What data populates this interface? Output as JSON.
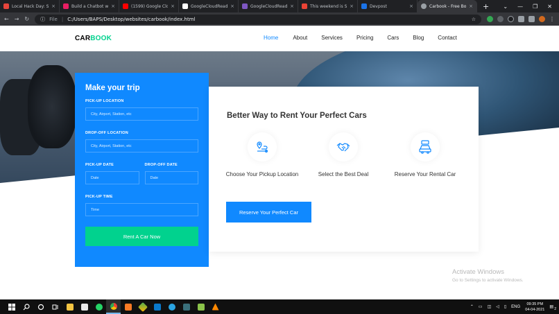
{
  "browser": {
    "tabs": [
      {
        "label": "Local Hack Day: Sh",
        "color": "#e8453c"
      },
      {
        "label": "Build a Chatbot w",
        "color": "#e91e63"
      },
      {
        "label": "(1599) Google Clo",
        "color": "#ff0000"
      },
      {
        "label": "GoogleCloudReady",
        "color": "#ffffff"
      },
      {
        "label": "GoogleCloudReady",
        "color": "#7e57c2"
      },
      {
        "label": "This weekend is S",
        "color": "#ea4335"
      },
      {
        "label": "Devpost",
        "color": "#1a73e8"
      },
      {
        "label": "Carbook - Free Bo",
        "color": "#9aa0a6"
      }
    ],
    "new_tab_symbol": "+",
    "file_label": "File",
    "url": "C:/Users/BAPS/Desktop/websites/carbook/index.html"
  },
  "site": {
    "logo_part1": "CAR",
    "logo_part2": "BOOK",
    "nav": [
      "Home",
      "About",
      "Services",
      "Pricing",
      "Cars",
      "Blog",
      "Contact"
    ],
    "active_nav": "Home",
    "form": {
      "title": "Make your trip",
      "pickup_location_label": "PICK-UP LOCATION",
      "pickup_location_placeholder": "City, Airport, Station, etc",
      "dropoff_location_label": "DROP-OFF LOCATION",
      "dropoff_location_placeholder": "City, Airport, Station, etc",
      "pickup_date_label": "PICK-UP DATE",
      "pickup_date_placeholder": "Date",
      "dropoff_date_label": "DROP-OFF DATE",
      "dropoff_date_placeholder": "Date",
      "pickup_time_label": "PICK-UP TIME",
      "pickup_time_placeholder": "Time",
      "submit_label": "Rent A Car Now"
    },
    "panel": {
      "heading": "Better Way to Rent Your Perfect Cars",
      "features": [
        {
          "label": "Choose Your Pickup Location",
          "icon": "map-pin-route-icon"
        },
        {
          "label": "Select the Best Deal",
          "icon": "handshake-icon"
        },
        {
          "label": "Reserve Your Rental Car",
          "icon": "car-icon"
        }
      ],
      "reserve_label": "Reserve Your Perfect Car"
    }
  },
  "watermark": {
    "line1": "Activate Windows",
    "line2": "Go to Settings to activate Windows."
  },
  "taskbar": {
    "lang": "ENG",
    "time": "09:35 PM",
    "date": "04-04-2021",
    "notification_count": "2"
  },
  "colors": {
    "primary": "#1089ff",
    "accent": "#01d28e"
  }
}
